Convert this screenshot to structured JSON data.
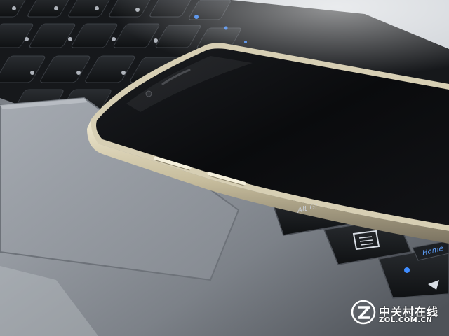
{
  "photo": {
    "keys": {
      "altgr_label": "Alt Gr",
      "home_label": "Home"
    },
    "watermark": {
      "brand_cn": "中关村在线",
      "brand_en": "ZOL.COM.CN"
    },
    "colors": {
      "laptop_body": "#8e939a",
      "keyboard_key": "#15171a",
      "phone_frame": "#cfc6a8",
      "phone_screen": "#0b0c0e",
      "key_backlight": "#3f8cff"
    }
  }
}
